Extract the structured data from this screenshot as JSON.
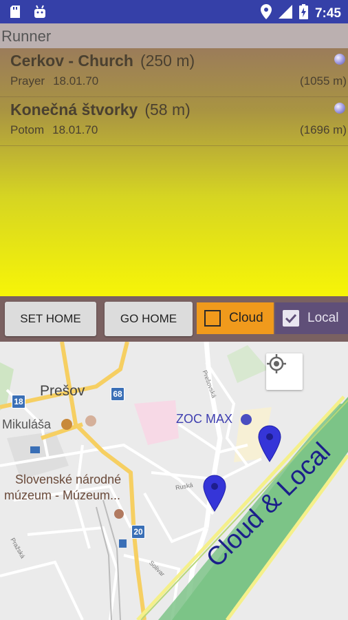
{
  "status_bar": {
    "time": "7:45"
  },
  "app": {
    "title": "Runner"
  },
  "list": [
    {
      "name": "Cerkov - Church",
      "distance": "(250 m)",
      "note": "Prayer",
      "date": "18.01.70",
      "total": "(1055 m)"
    },
    {
      "name": "Konečná štvorky",
      "distance": "(58 m)",
      "note": "Potom",
      "date": "18.01.70",
      "total": "(1696 m)"
    }
  ],
  "toolbar": {
    "set_home": "SET HOME",
    "go_home": "GO HOME",
    "cloud": {
      "label": "Cloud",
      "checked": false,
      "bg": "#f09a1c"
    },
    "local": {
      "label": "Local",
      "checked": true,
      "bg": "#5f4f78"
    }
  },
  "map": {
    "labels": {
      "presov": "Prešov",
      "mikulasa": "Mikuláša",
      "zoc_max": "ZOC MAX",
      "museum_line1": "Slovenské národné",
      "museum_line2": "múzeum - Múzeum...",
      "street1": "Prešovská",
      "street2": "Ruská",
      "street3": "Pražská",
      "street4": "Solivar"
    },
    "shields": [
      "18",
      "68",
      "20"
    ],
    "band_label": "Cloud & Local",
    "marker_color": "#3535d8"
  }
}
